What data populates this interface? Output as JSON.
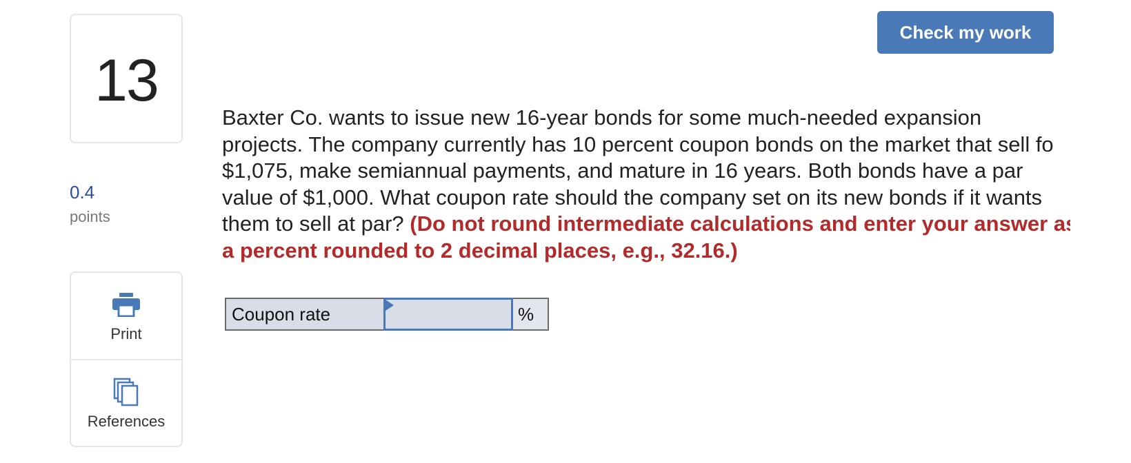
{
  "question": {
    "number": "13",
    "points_value": "0.4",
    "points_label": "points",
    "text_lines": [
      "Baxter Co. wants to issue new 16-year bonds for some much-needed expansion",
      "projects. The company currently has 10 percent coupon bonds on the market that sell fo",
      "$1,075, make semiannual payments, and mature in 16 years. Both bonds have a par",
      "value of $1,000. What coupon rate should the company set on its new bonds if it wants"
    ],
    "text_line5_plain": "them to sell at par? ",
    "instruction_line1": "(Do not round intermediate calculations and enter your answer as",
    "instruction_line2": "a percent rounded to 2 decimal places, e.g., 32.16.)"
  },
  "header": {
    "check_button_label": "Check my work",
    "check_button_color": "#4a79b8"
  },
  "tools": {
    "print_label": "Print",
    "print_icon": "printer-icon",
    "references_label": "References",
    "references_icon": "documents-stack-icon"
  },
  "answer": {
    "label": "Coupon rate",
    "value": "",
    "unit": "%"
  },
  "colors": {
    "accent": "#4a79b8",
    "instruction": "#b22a2a",
    "points": "#2a4f9a",
    "input_background": "#d9dde8"
  }
}
